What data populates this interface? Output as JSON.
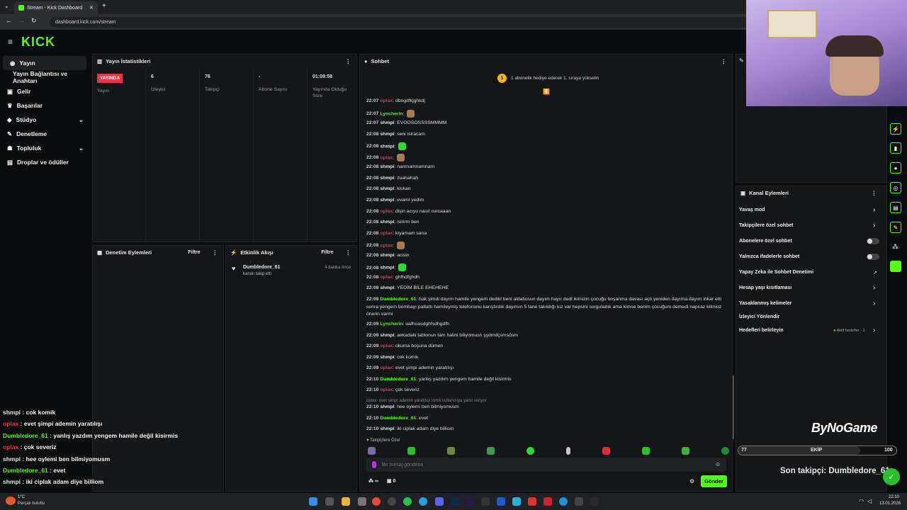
{
  "browser": {
    "tab_title": "Stream - Kick Dashboard",
    "url": "dashboard.kick.com/stream"
  },
  "app": {
    "logo": "KICK"
  },
  "sidebar": {
    "items": [
      {
        "label": "Yayın",
        "icon": "broadcast-icon"
      },
      {
        "label": "Yayın Bağlantısı ve Anahtarı",
        "icon": ""
      },
      {
        "label": "Gelir",
        "icon": "money-icon"
      },
      {
        "label": "Başarılar",
        "icon": "trophy-icon"
      },
      {
        "label": "Stüdyo",
        "icon": "studio-icon"
      },
      {
        "label": "Denetleme",
        "icon": "wrench-icon"
      },
      {
        "label": "Topluluk",
        "icon": "community-icon"
      },
      {
        "label": "Droplar ve ödüller",
        "icon": "gift-icon"
      }
    ]
  },
  "stats": {
    "title": "Yayın İstatistikleri",
    "live_badge": "YAYINDA",
    "items": [
      {
        "value": "6",
        "label": "İzleyici"
      },
      {
        "value": "76",
        "label": "Takipçi"
      },
      {
        "value": "-",
        "label": "Abone Sayısı"
      },
      {
        "value": "01:09:58",
        "label": "Yayında Olduğu Süre"
      }
    ],
    "first_label": "Yayın"
  },
  "moderation": {
    "title": "Denetim Eylemleri",
    "filter": "Filtre"
  },
  "activity": {
    "title": "Etkinlik Akışı",
    "filter": "Filtre",
    "event_user": "Dumbledore_61",
    "event_text": "kanalı takip etti",
    "event_time": "4 dakika önce"
  },
  "chat": {
    "title": "Sohbet",
    "banner": "1 abonelik hediye ederek 1. sıraya yükselin",
    "banner_num": "1",
    "reply_note": "oplax: evet şimpi ademin yaratılışı isimli kullanıcıya yanıt veriyor",
    "followers_only": "Takipçilere Özel",
    "input_placeholder": "Bir mesaj gönderin",
    "send": "Gönder",
    "counter_a": "∞",
    "counter_b": "0",
    "messages": [
      {
        "t": "22:07",
        "u": "oplax",
        "c": "r",
        "m": "dbngdfkjghkdj"
      },
      {
        "t": "22:07",
        "u": "Lyncherin",
        "c": "g",
        "m": ""
      },
      {
        "t": "22:07",
        "u": "shmpi",
        "c": "w",
        "m": "EVOOSOSSSSMMMM"
      },
      {
        "t": "22:08",
        "u": "shmpi",
        "c": "w",
        "m": "seni isiracam"
      },
      {
        "t": "22:08",
        "u": "shmpi",
        "c": "w",
        "m": ""
      },
      {
        "t": "22:08",
        "u": "oplax",
        "c": "r",
        "m": ""
      },
      {
        "t": "22:08",
        "u": "shmpi",
        "c": "w",
        "m": "namnamnamnam"
      },
      {
        "t": "22:08",
        "u": "shmpi",
        "c": "w",
        "m": "zuahahah"
      },
      {
        "t": "22:08",
        "u": "shmpi",
        "c": "w",
        "m": "kiskan"
      },
      {
        "t": "22:08",
        "u": "shmpi",
        "c": "w",
        "m": "evami yedim"
      },
      {
        "t": "22:08",
        "u": "oplax",
        "c": "r",
        "m": "dişin acıyo nasıl ısırcaaan"
      },
      {
        "t": "22:08",
        "u": "shmpi",
        "c": "w",
        "m": "isirirm ben"
      },
      {
        "t": "22:08",
        "u": "oplax",
        "c": "r",
        "m": "kıyamam sana"
      },
      {
        "t": "22:08",
        "u": "oplax",
        "c": "r",
        "m": ""
      },
      {
        "t": "22:08",
        "u": "shmpi",
        "c": "w",
        "m": "acisin"
      },
      {
        "t": "22:08",
        "u": "shmpi",
        "c": "w",
        "m": ""
      },
      {
        "t": "22:08",
        "u": "oplax",
        "c": "r",
        "m": "ghfhdfghdh"
      },
      {
        "t": "22:08",
        "u": "shmpi",
        "c": "w",
        "m": "YEDİM BİLE EHEHEHE"
      }
    ],
    "long_message": {
      "t": "22:09",
      "u": "Dumbledore_61",
      "lines": [
        "bak şimdi dayım hamile yengem dedikl beni aldatiosun dayım hayır dedi ikimizin çocuğu boşanma davası açtı yeniden dayıma dayım inkar etti",
        "sonra yengem bombayı patlattı hamileymiş telefonunu karıştırdık dayımın 5 tane takıldığı kız var hepsini sorguladık ama kimse benim çocuğum demedi napcaz bilmioz",
        "önerin varmi"
      ]
    },
    "messages2": [
      {
        "t": "22:09",
        "u": "Lyncherin",
        "c": "g",
        "m": "uafhuasdghfsdhgdfh"
      },
      {
        "t": "22:09",
        "u": "shmpi",
        "c": "w",
        "m": "aekadaki tablonun tam halini biliyomusn şşdmdçsmsösm"
      },
      {
        "t": "22:09",
        "u": "oplax",
        "c": "r",
        "m": "okuma boşuna dümen"
      },
      {
        "t": "22:09",
        "u": "shmpi",
        "c": "w",
        "m": "cok komik"
      },
      {
        "t": "22:09",
        "u": "oplax",
        "c": "r",
        "m": "evet şimpi ademin yaratılışı"
      },
      {
        "t": "22:10",
        "u": "Dumbledore_61",
        "c": "g",
        "m": "yanlış yazdım yengem hamile değil kisirmis"
      },
      {
        "t": "22:10",
        "u": "oplax",
        "c": "r",
        "m": "çok severiz"
      }
    ],
    "messages3": [
      {
        "t": "22:10",
        "u": "shmpi",
        "c": "w",
        "m": "hee oylemi ben bilmiyomusm"
      },
      {
        "t": "22:10",
        "u": "Dumbledore_61",
        "c": "g",
        "m": "evet"
      },
      {
        "t": "22:10",
        "u": "shmpi",
        "c": "w",
        "m": "iki ciplak adam diye billiom"
      }
    ]
  },
  "channel_actions": {
    "title": "Kanal Eylemleri",
    "items": [
      {
        "label": "Yavaş mod",
        "kind": "arrow"
      },
      {
        "label": "Takipçilere özel sohbet",
        "kind": "arrow"
      },
      {
        "label": "Abonelere özel sohbet",
        "kind": "toggle"
      },
      {
        "label": "Yalnızca ifadelerle sohbet",
        "kind": "toggle"
      },
      {
        "label": "Yapay Zeka ile Sohbet Denetimi",
        "kind": "ext"
      },
      {
        "label": "Hesap yaşı kısıtlaması",
        "kind": "arrow"
      },
      {
        "label": "Yasaklanmış kelimeler",
        "kind": "arrow"
      },
      {
        "label": "İzleyici Yönlendir",
        "kind": "none"
      },
      {
        "label": "Hedefleri belirleyin",
        "kind": "arrow"
      }
    ],
    "goals_status": "Aktif hedefler - 1"
  },
  "overlay": {
    "brand": "ByNoGame",
    "bar_left": "77",
    "bar_mid": "EKİP",
    "bar_right": "100",
    "last_follower": "Son takipçi: Dumbledore_61",
    "chat": [
      {
        "u": "shmpi",
        "c": "w",
        "m": "cok komik"
      },
      {
        "u": "oplax",
        "c": "r",
        "m": "evet şimpi ademin yaratılışı"
      },
      {
        "u": "Dumbledore_61",
        "c": "g",
        "m": "yanlış yazdım yengem hamile değil kisirmis"
      },
      {
        "u": "oplax",
        "c": "r",
        "m": "çok severiz"
      },
      {
        "u": "shmpi",
        "c": "w",
        "m": "hee oylemi ben bilmiyomusm"
      },
      {
        "u": "Dumbledore_61",
        "c": "g",
        "m": "evet"
      },
      {
        "u": "shmpi",
        "c": "w",
        "m": "iki ciplak adam diye billiom"
      }
    ]
  },
  "taskbar": {
    "weather_temp": "1°C",
    "weather_text": "Parçalı bulutlu",
    "time": "22:10",
    "date": "13.01.2026"
  },
  "colors": {
    "accent": "#53fc18",
    "live": "#e5354a"
  }
}
